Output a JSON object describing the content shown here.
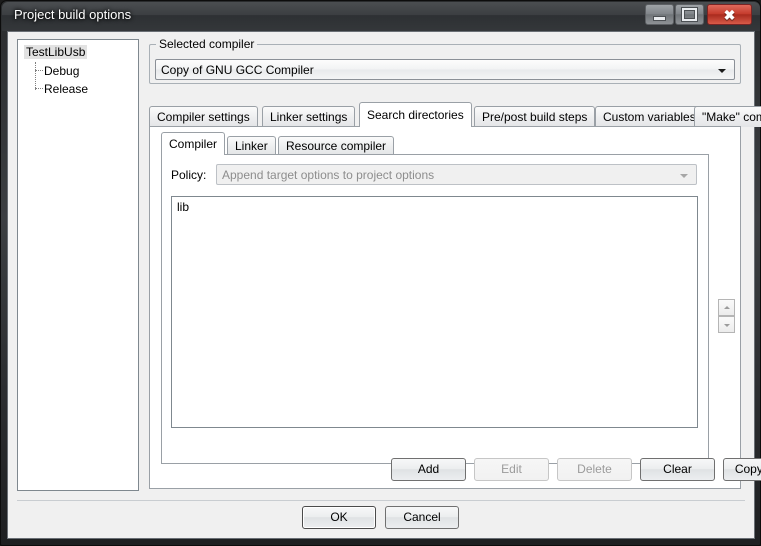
{
  "window": {
    "title": "Project build options",
    "controls": {
      "minimize": "minimize",
      "maximize": "maximize",
      "close": "close"
    }
  },
  "tree": {
    "root": "TestLibUsb",
    "children": [
      "Debug",
      "Release"
    ]
  },
  "selected_compiler": {
    "group_label": "Selected compiler",
    "value": "Copy of GNU GCC Compiler"
  },
  "tabs_outer": [
    {
      "label": "Compiler settings",
      "active": false
    },
    {
      "label": "Linker settings",
      "active": false
    },
    {
      "label": "Search directories",
      "active": true
    },
    {
      "label": "Pre/post build steps",
      "active": false
    },
    {
      "label": "Custom variables",
      "active": false
    },
    {
      "label": "\"Make\" commands",
      "active": false
    }
  ],
  "tabs_inner": [
    {
      "label": "Compiler",
      "active": true
    },
    {
      "label": "Linker",
      "active": false
    },
    {
      "label": "Resource compiler",
      "active": false
    }
  ],
  "policy": {
    "label": "Policy:",
    "value": "Append target options to project options"
  },
  "directories": {
    "items": [
      "lib"
    ]
  },
  "spin": {
    "up": "move-up",
    "down": "move-down"
  },
  "action_buttons": {
    "add": "Add",
    "edit": "Edit",
    "delete": "Delete",
    "clear": "Clear",
    "copy_to": "Copy to..."
  },
  "dialog_buttons": {
    "ok": "OK",
    "cancel": "Cancel"
  },
  "colors": {
    "dialog_bg": "#f0f0f0",
    "panel_bg": "#ffffff",
    "frame": "#2d3033",
    "close_btn": "#c43b2c",
    "disabled_text": "#9b9b9b",
    "tree_selection": "#e2e2e2"
  }
}
